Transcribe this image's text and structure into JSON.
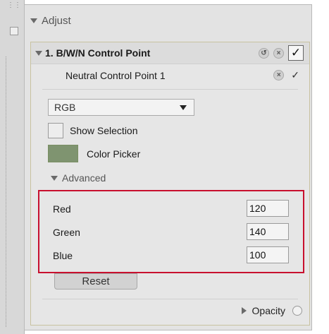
{
  "panel": {
    "section_label": "Adjust"
  },
  "control_point": {
    "title": "1. B/W/N Control Point",
    "reset_icon": "undo-icon",
    "delete_icon": "close-circle-icon",
    "enabled_check": "✓"
  },
  "neutral": {
    "label": "Neutral Control Point 1",
    "delete_icon": "close-circle-icon",
    "check_icon": "check-icon",
    "check_glyph": "✓"
  },
  "mode_select": {
    "value": "RGB"
  },
  "show_selection": {
    "label": "Show Selection",
    "checked": false
  },
  "color_picker": {
    "label": "Color Picker",
    "swatch_color": "#7f9470"
  },
  "advanced": {
    "label": "Advanced",
    "fields": [
      {
        "label": "Red",
        "value": "120"
      },
      {
        "label": "Green",
        "value": "140"
      },
      {
        "label": "Blue",
        "value": "100"
      }
    ]
  },
  "reset_button": {
    "label": "Reset"
  },
  "opacity": {
    "label": "Opacity"
  },
  "colors": {
    "highlight_border": "#c8102e",
    "panel_bg": "#e3e3e3"
  }
}
